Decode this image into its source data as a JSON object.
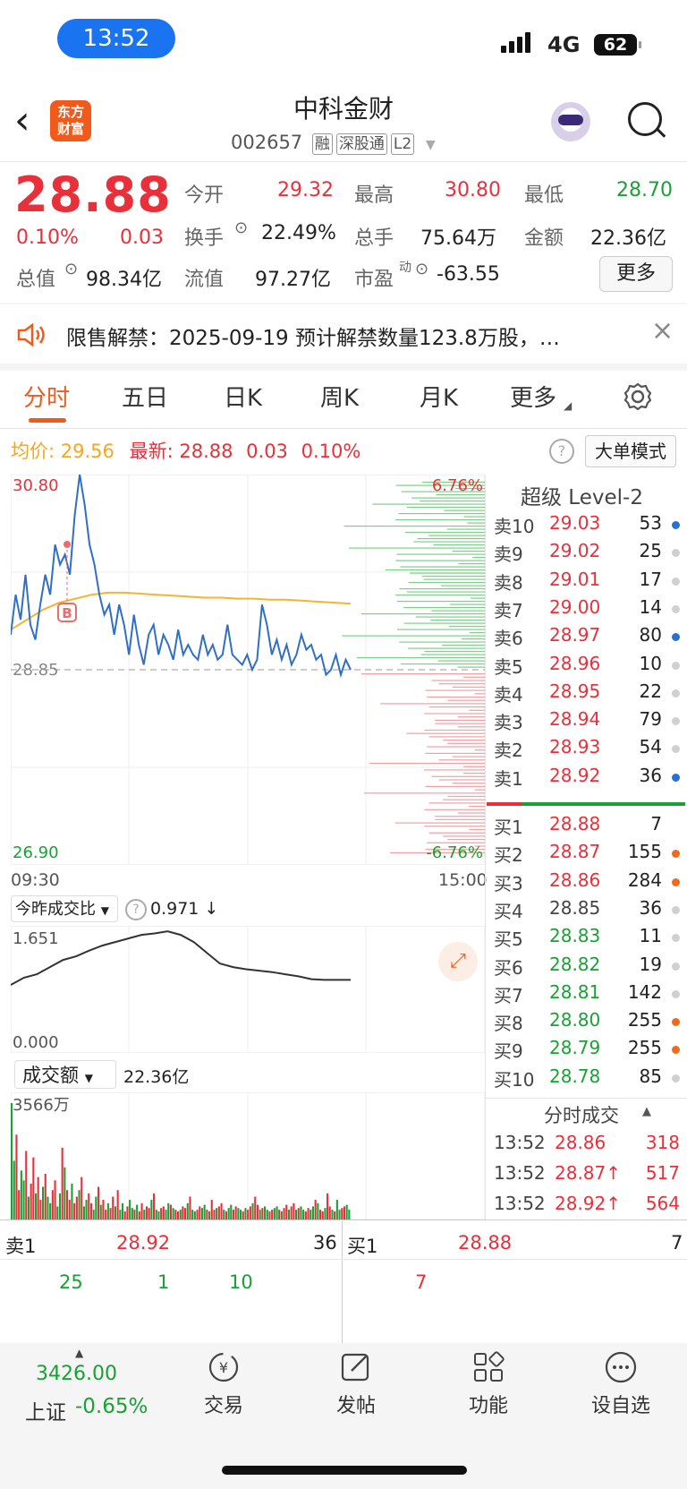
{
  "status_bar": {
    "time": "13:52",
    "network": "4G",
    "battery": "62"
  },
  "header": {
    "logo_text_1": "东方",
    "logo_text_2": "财富",
    "stock_name": "中科金财",
    "stock_code": "002657",
    "tags": [
      "融",
      "深股通",
      "L2"
    ]
  },
  "quote": {
    "price": "28.88",
    "change_pct": "0.10%",
    "change": "0.03",
    "open_label": "今开",
    "open": "29.32",
    "high_label": "最高",
    "high": "30.80",
    "low_label": "最低",
    "low": "28.70",
    "turnover_label": "换手",
    "turnover": "22.49%",
    "volume_label": "总手",
    "volume": "75.64万",
    "amount_label": "金额",
    "amount": "22.36亿",
    "mktcap_label": "总值",
    "mktcap": "98.34亿",
    "float_label": "流值",
    "float_cap": "97.27亿",
    "pe_label": "市盈",
    "pe_sup": "动",
    "pe": "-63.55",
    "more_button": "更多"
  },
  "notice": {
    "text": "限售解禁：2025-09-19 预计解禁数量123.8万股，…",
    "close": "×"
  },
  "tabs": [
    {
      "label": "分时",
      "active": true
    },
    {
      "label": "五日"
    },
    {
      "label": "日K"
    },
    {
      "label": "周K"
    },
    {
      "label": "月K"
    },
    {
      "label": "更多"
    }
  ],
  "info_row": {
    "avg_label": "均价:",
    "avg": "29.56",
    "latest_label": "最新:",
    "latest": "28.88",
    "latest_change": "0.03",
    "latest_pct": "0.10%",
    "big_order_button": "大单模式"
  },
  "chart_data": [
    {
      "type": "line",
      "title": "分时",
      "y_top_label": "30.80",
      "y_bottom_label": "26.90",
      "pct_top_label": "6.76%",
      "pct_bottom_label": "-6.76%",
      "ref_label": "28.85",
      "x_start_label": "09:30",
      "x_end_label": "15:00",
      "ylim": [
        26.9,
        30.8
      ],
      "marker_label": "B",
      "series": [
        {
          "values": [
            29.2,
            29.6,
            29.35,
            29.8,
            29.3,
            29.15,
            29.5,
            29.8,
            29.6,
            30.1,
            29.9,
            30.0,
            29.8,
            30.4,
            30.8,
            30.5,
            30.1,
            29.9,
            29.6,
            29.4,
            29.5,
            29.2,
            29.5,
            29.3,
            29.0,
            29.4,
            29.1,
            28.9,
            29.2,
            29.3,
            29.0,
            29.2,
            29.1,
            28.95,
            29.25,
            29.0,
            29.1,
            29.0,
            28.95,
            29.2,
            29.0,
            29.1,
            28.95,
            29.0,
            29.3,
            29.0,
            28.95,
            28.9,
            29.0,
            28.85,
            28.95,
            29.5,
            29.3,
            29.0,
            29.15,
            28.95,
            29.1,
            28.9,
            29.0,
            29.2,
            29.05,
            29.1,
            28.95,
            29.0,
            28.8,
            28.85,
            29.0,
            28.8,
            28.95,
            28.85
          ]
        },
        {
          "values": [
            29.25,
            29.35,
            29.45,
            29.52,
            29.56,
            29.6,
            29.62,
            29.62,
            29.61,
            29.6,
            29.59,
            29.58,
            29.57,
            29.57,
            29.56,
            29.56,
            29.55,
            29.55,
            29.54,
            29.53,
            29.52,
            29.51
          ]
        }
      ]
    },
    {
      "type": "line",
      "title": "今昨成交比",
      "current_value": "0.971",
      "y_top_label": "1.651",
      "y_bottom_label": "0.000",
      "ylim": [
        0,
        1.651
      ],
      "series": [
        {
          "values": [
            0.9,
            1.0,
            1.05,
            1.15,
            1.25,
            1.3,
            1.38,
            1.45,
            1.5,
            1.55,
            1.6,
            1.62,
            1.65,
            1.6,
            1.5,
            1.35,
            1.2,
            1.15,
            1.12,
            1.1,
            1.08,
            1.05,
            1.02,
            0.98,
            0.97,
            0.97,
            0.971
          ]
        }
      ]
    },
    {
      "type": "bar",
      "title": "成交额",
      "total": "22.36亿",
      "y_top_label": "3566万",
      "values": [
        3566,
        1800,
        2600,
        900,
        1500,
        1200,
        2100,
        700,
        1100,
        1900,
        800,
        1300,
        600,
        1000,
        1400,
        700,
        500,
        900,
        1200,
        400,
        800,
        2200,
        1600,
        900,
        600,
        1100,
        500,
        700,
        900,
        1300,
        400,
        600,
        800,
        500,
        300,
        700,
        1000,
        450,
        600,
        300,
        500,
        350,
        700,
        400,
        900,
        300,
        500,
        250,
        400,
        600,
        350,
        300,
        450,
        250,
        500,
        300,
        400,
        350,
        600,
        800,
        300,
        250,
        350,
        400,
        300,
        500,
        450,
        350,
        300,
        250,
        300,
        400,
        350,
        500,
        700,
        300,
        250,
        300,
        400,
        350,
        450,
        300,
        250,
        600,
        300,
        350,
        400,
        500,
        300,
        250,
        350,
        450,
        300,
        400,
        350,
        300,
        250,
        350,
        300,
        400,
        500,
        700,
        450,
        300,
        350,
        400,
        300,
        250,
        300,
        350,
        400,
        300,
        250,
        350,
        450,
        300,
        400,
        500,
        300,
        350,
        400,
        300,
        250,
        350,
        300,
        400,
        600,
        500,
        300,
        250,
        350,
        800,
        400,
        300,
        250,
        600,
        300,
        350,
        400,
        450,
        300
      ]
    }
  ],
  "orderbook": {
    "title": "超级 Level-2",
    "asks": [
      {
        "label": "卖10",
        "price": "29.03",
        "vol": "53",
        "dot": "#2a6fd6"
      },
      {
        "label": "卖9",
        "price": "29.02",
        "vol": "25",
        "dot": "#d0d0d0"
      },
      {
        "label": "卖8",
        "price": "29.01",
        "vol": "17",
        "dot": "#d0d0d0"
      },
      {
        "label": "卖7",
        "price": "29.00",
        "vol": "14",
        "dot": "#d0d0d0"
      },
      {
        "label": "卖6",
        "price": "28.97",
        "vol": "80",
        "dot": "#2a6fd6"
      },
      {
        "label": "卖5",
        "price": "28.96",
        "vol": "10",
        "dot": "#d0d0d0"
      },
      {
        "label": "卖4",
        "price": "28.95",
        "vol": "22",
        "dot": "#d0d0d0"
      },
      {
        "label": "卖3",
        "price": "28.94",
        "vol": "79",
        "dot": "#d0d0d0"
      },
      {
        "label": "卖2",
        "price": "28.93",
        "vol": "54",
        "dot": "#d0d0d0"
      },
      {
        "label": "卖1",
        "price": "28.92",
        "vol": "36",
        "dot": "#2a6fd6"
      }
    ],
    "bids": [
      {
        "label": "买1",
        "price": "28.88",
        "vol": "7",
        "dot": "",
        "color": "red"
      },
      {
        "label": "买2",
        "price": "28.87",
        "vol": "155",
        "dot": "#f06a1a",
        "color": "red"
      },
      {
        "label": "买3",
        "price": "28.86",
        "vol": "284",
        "dot": "#f06a1a",
        "color": "red"
      },
      {
        "label": "买4",
        "price": "28.85",
        "vol": "36",
        "dot": "#d0d0d0",
        "color": "grey"
      },
      {
        "label": "买5",
        "price": "28.83",
        "vol": "11",
        "dot": "#d0d0d0",
        "color": "green"
      },
      {
        "label": "买6",
        "price": "28.82",
        "vol": "19",
        "dot": "#d0d0d0",
        "color": "green"
      },
      {
        "label": "买7",
        "price": "28.81",
        "vol": "142",
        "dot": "#d0d0d0",
        "color": "green"
      },
      {
        "label": "买8",
        "price": "28.80",
        "vol": "255",
        "dot": "#f06a1a",
        "color": "green"
      },
      {
        "label": "买9",
        "price": "28.79",
        "vol": "255",
        "dot": "#f06a1a",
        "color": "green"
      },
      {
        "label": "买10",
        "price": "28.78",
        "vol": "85",
        "dot": "#d0d0d0",
        "color": "green"
      }
    ],
    "trades_title": "分时成交",
    "trades": [
      {
        "time": "13:52",
        "price": "28.86",
        "vol": "318"
      },
      {
        "time": "13:52",
        "price": "28.87↑",
        "vol": "517"
      },
      {
        "time": "13:52",
        "price": "28.92↑",
        "vol": "564"
      }
    ]
  },
  "queue": {
    "sell_label": "卖1",
    "sell_price": "28.92",
    "sell_vol": "36",
    "sell_items": [
      "25",
      "1",
      "10"
    ],
    "buy_label": "买1",
    "buy_price": "28.88",
    "buy_vol": "7",
    "buy_items": [
      "7"
    ]
  },
  "bottom_nav": {
    "index_value": "3426.00",
    "index_name": "上证",
    "index_change": "-0.65%",
    "items": [
      "交易",
      "发帖",
      "功能",
      "设自选"
    ]
  },
  "colors": {
    "up": "#e8303a",
    "down": "#1aa035",
    "accent": "#f25a1c",
    "price_line": "#2f6fc4",
    "avg_line": "#f5b335"
  }
}
